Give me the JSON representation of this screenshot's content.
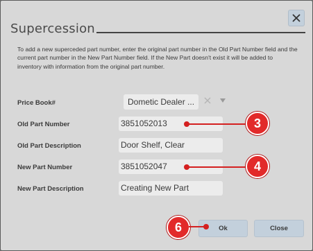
{
  "dialog": {
    "title": "Supercession",
    "description": "To add a new superceded part number, enter the original part number in the Old Part Number field and the current part number in the New Part Number field. If the New Part doesn't exist it will be added to inventory with information from the original part number."
  },
  "form": {
    "price_book_label": "Price Book#",
    "price_book_value": "Dometic Dealer ...",
    "old_part_number_label": "Old Part Number",
    "old_part_number_value": "3851052013",
    "old_part_description_label": "Old Part Description",
    "old_part_description_value": "Door Shelf, Clear",
    "new_part_number_label": "New Part Number",
    "new_part_number_value": "3851052047",
    "new_part_description_label": "New Part Description",
    "new_part_description_value": "Creating New Part"
  },
  "buttons": {
    "ok_label": "Ok",
    "close_label": "Close"
  },
  "callouts": {
    "step3": "3",
    "step4": "4",
    "step6": "6"
  },
  "icons": {
    "close": "close-icon",
    "clear": "clear-x-icon",
    "dropdown": "caret-down-icon"
  },
  "colors": {
    "accent": "#c3d0dc",
    "callout": "#e22a2a",
    "background": "#d8d8d8"
  }
}
